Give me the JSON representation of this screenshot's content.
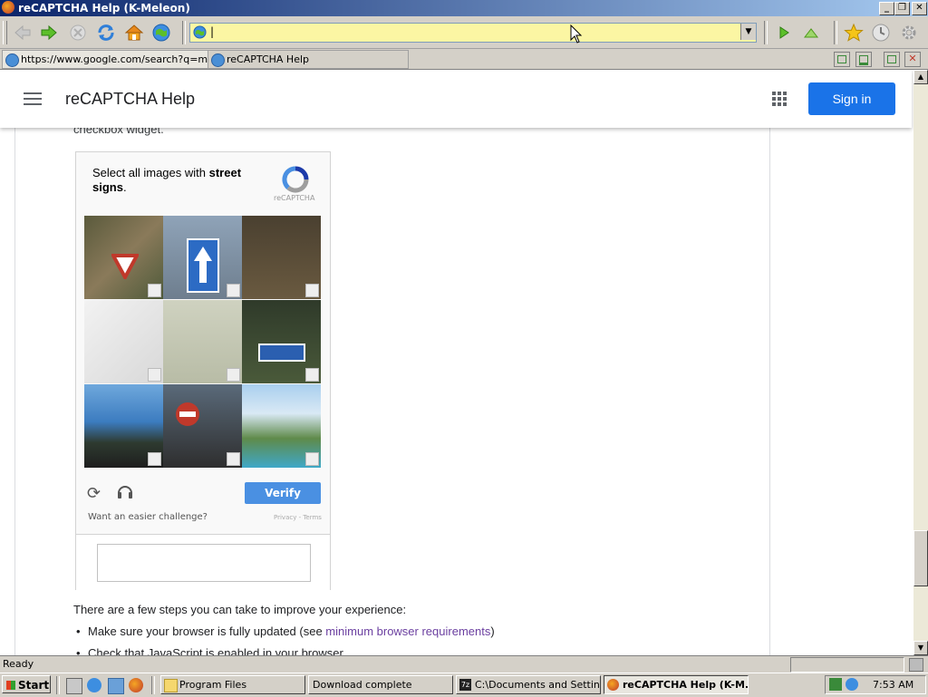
{
  "window": {
    "title": "reCAPTCHA Help (K-Meleon)",
    "controls": {
      "minimize": "_",
      "restore": "❐",
      "close": "✕"
    }
  },
  "toolbar": {
    "icons": [
      "back-icon",
      "forward-icon",
      "stop-icon",
      "reload-icon",
      "home-icon",
      "browser-globe-icon"
    ],
    "url_value": "|",
    "right_icons": [
      "go-icon",
      "up-icon",
      "bookmarks-star-icon",
      "history-icon",
      "settings-gear-icon"
    ]
  },
  "tabs": [
    {
      "label": "https://www.google.com/search?q=mi..."
    },
    {
      "label": "reCAPTCHA Help"
    }
  ],
  "header": {
    "site_title": "reCAPTCHA Help",
    "signin_label": "Sign in"
  },
  "content": {
    "cutoff_text": "checkbox widget.",
    "captcha": {
      "prompt_pre": "Select all images with ",
      "prompt_bold": "street signs",
      "prompt_post": ".",
      "logo_text": "reCAPTCHA",
      "verify_label": "Verify",
      "easier_label": "Want an easier challenge?",
      "privacy_terms": "Privacy - Terms"
    },
    "intro": "There are a few steps you can take to improve your experience:",
    "bullet1_pre": "Make sure your browser is fully updated (see ",
    "bullet1_link": "minimum browser requirements",
    "bullet1_post": ")",
    "bullet2": "Check that JavaScript is enabled in your browser"
  },
  "status": {
    "text": "Ready"
  },
  "taskbar": {
    "start_label": "Start",
    "tasks": [
      {
        "label": "Program Files"
      },
      {
        "label": "Download complete"
      },
      {
        "label": "C:\\Documents and Settin..."
      },
      {
        "label": "reCAPTCHA Help (K-M..."
      }
    ],
    "clock": "7:53 AM"
  },
  "colors": {
    "accent": "#1a73e8",
    "verify": "#4a90e2",
    "url_bg": "#fbf6a3"
  }
}
